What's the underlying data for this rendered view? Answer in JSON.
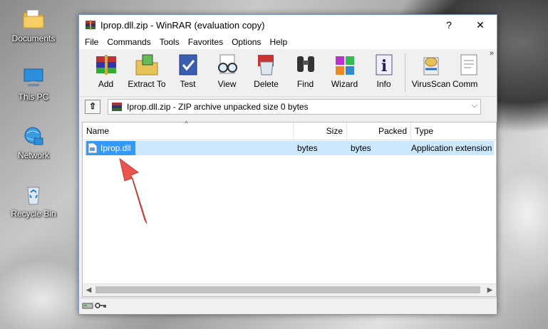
{
  "desktop": {
    "icons": [
      {
        "label": "Documents",
        "icon": "folder-icon"
      },
      {
        "label": "This PC",
        "icon": "computer-icon"
      },
      {
        "label": "Network",
        "icon": "network-icon"
      },
      {
        "label": "Recycle Bin",
        "icon": "recycle-bin-icon"
      }
    ]
  },
  "window": {
    "title": "Iprop.dll.zip - WinRAR (evaluation copy)",
    "help_button": "?",
    "close_button": "✕"
  },
  "menu": [
    "File",
    "Commands",
    "Tools",
    "Favorites",
    "Options",
    "Help"
  ],
  "toolbar": {
    "buttons": [
      "Add",
      "Extract To",
      "Test",
      "View",
      "Delete",
      "Find",
      "Wizard",
      "Info",
      "VirusScan",
      "Comm"
    ],
    "overflow": "»"
  },
  "address": {
    "up_button": "⇧",
    "text": "Iprop.dll.zip - ZIP archive unpacked size 0 bytes"
  },
  "file_list": {
    "columns": [
      "Name",
      "Size",
      "Packed",
      "Type"
    ],
    "sort_indicator": "^",
    "rows": [
      {
        "name": "Iprop.dll",
        "size": "bytes",
        "packed": "bytes",
        "type": "Application extension"
      }
    ]
  },
  "colors": {
    "selection": "#3399ff",
    "selection_row": "#cce8ff",
    "arrow": "#e8554e"
  }
}
